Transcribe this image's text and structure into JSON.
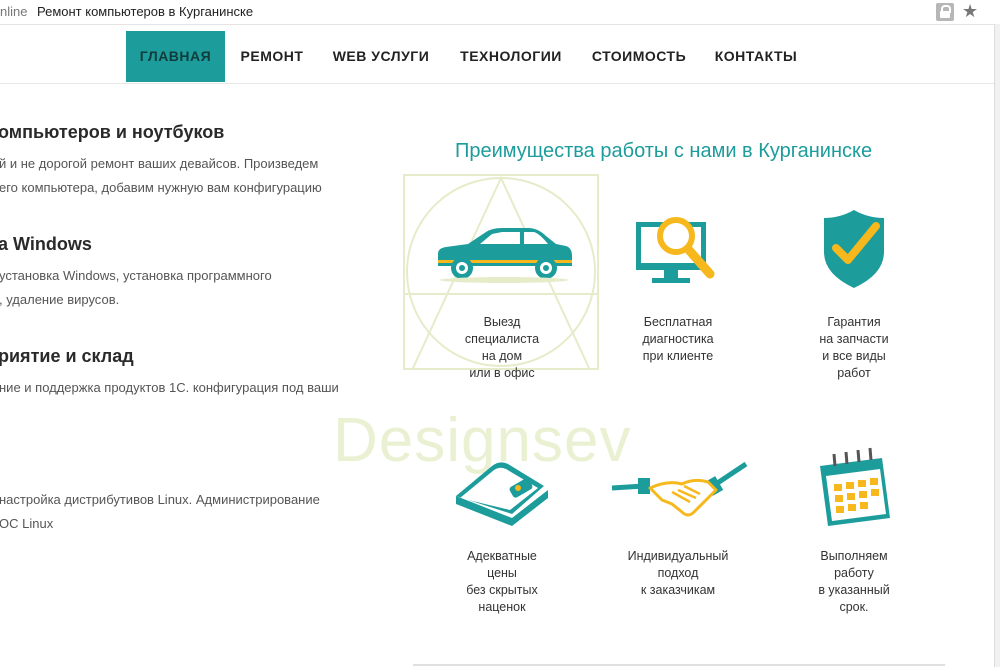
{
  "browser": {
    "host_fragment": "nline",
    "page_title": "Ремонт компьютеров в Курганинске",
    "lock_icon": "lock-icon",
    "star_icon": "star-icon"
  },
  "nav": {
    "items": [
      {
        "label": "ГЛАВНАЯ",
        "active": true
      },
      {
        "label": "РЕМОНТ",
        "active": false
      },
      {
        "label": "WEB УСЛУГИ",
        "active": false
      },
      {
        "label": "ТЕХНОЛОГИИ",
        "active": false
      },
      {
        "label": "СТОИМОСТЬ",
        "active": false
      },
      {
        "label": "КОНТАКТЫ",
        "active": false
      }
    ],
    "active_color": "#1d9c9c"
  },
  "sections": [
    {
      "title": "омпьютеров и ноутбуков",
      "lines": [
        "й и не дорогой ремонт ваших девайсов. Произведем",
        "его компьютера, добавим нужную вам конфигурацию"
      ]
    },
    {
      "title": "а Windows",
      "lines": [
        "установка Windows, установка программного",
        ", удаление вирусов."
      ]
    },
    {
      "title": "риятие и склад",
      "lines": [
        "ние и поддержка продуктов 1С. конфигурация под ваши"
      ]
    },
    {
      "title": "",
      "lines": [
        "настройка дистрибутивов Linux. Администрирование",
        "ОС Linux"
      ]
    }
  ],
  "advantages": {
    "title": "Преимущества работы с нами в Курганинске",
    "accent_color": "#1d9c9c",
    "highlight_color": "#f6b81c",
    "features": [
      {
        "icon": "car-icon",
        "caption": [
          "Выезд",
          "специалиста",
          "на дом",
          "или в офис"
        ]
      },
      {
        "icon": "monitor-magnifier-icon",
        "caption": [
          "Бесплатная",
          "диагностика",
          "при клиенте"
        ]
      },
      {
        "icon": "shield-check-icon",
        "caption": [
          "Гарантия",
          "на запчасти",
          "и все виды",
          "работ"
        ]
      },
      {
        "icon": "wallet-icon",
        "caption": [
          "Адекватные",
          "цены",
          "без скрытых",
          "наценок"
        ]
      },
      {
        "icon": "handshake-icon",
        "caption": [
          "Индивидуальный",
          "подход",
          "к заказчикам"
        ]
      },
      {
        "icon": "calendar-icon",
        "caption": [
          "Выполняем",
          "работу",
          "в указанный",
          "срок."
        ]
      }
    ]
  },
  "watermark": {
    "text": "Designsev"
  }
}
